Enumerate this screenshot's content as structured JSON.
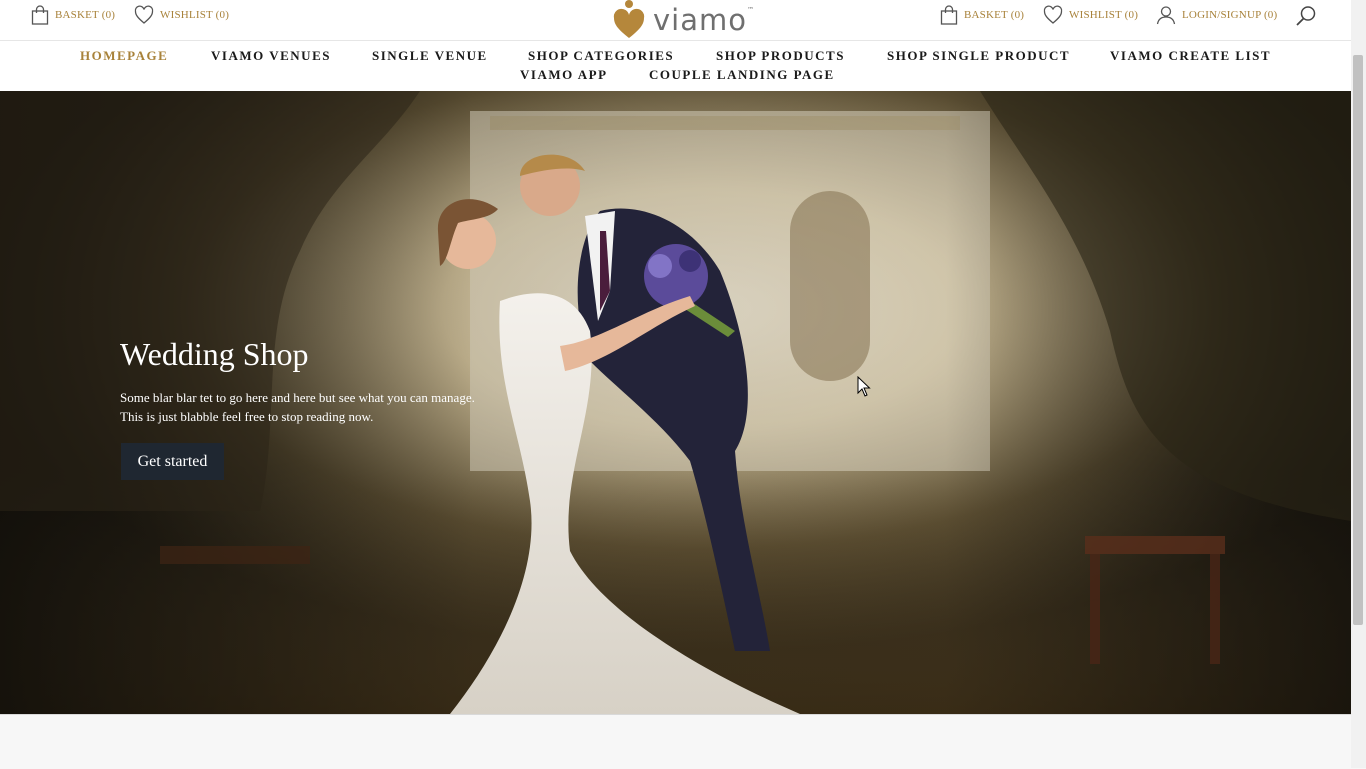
{
  "header": {
    "left_basket": {
      "label": "BASKET (0)",
      "icon": "shopping-bag-icon"
    },
    "left_wishlist": {
      "label": "WISHLIST (0)",
      "icon": "heart-icon"
    },
    "logo": {
      "text": "viamo",
      "tm": "™"
    },
    "right_basket": {
      "label": "BASKET (0)",
      "icon": "shopping-bag-icon"
    },
    "right_wishlist": {
      "label": "WISHLIST (0)",
      "icon": "heart-icon"
    },
    "login": {
      "label": "LOGIN/SIGNUP (0)",
      "icon": "user-icon"
    },
    "search_icon": "search-icon"
  },
  "nav": {
    "items": [
      {
        "label": "HOMEPAGE",
        "active": true
      },
      {
        "label": "VIAMO VENUES"
      },
      {
        "label": "SINGLE VENUE"
      },
      {
        "label": "SHOP CATEGORIES"
      },
      {
        "label": "SHOP PRODUCTS"
      },
      {
        "label": "SHOP SINGLE PRODUCT"
      },
      {
        "label": "VIAMO CREATE LIST"
      },
      {
        "label": "VIAMO APP"
      },
      {
        "label": "COUPLE LANDING PAGE"
      }
    ]
  },
  "hero": {
    "title": "Wedding Shop",
    "subtitle_line1": "Some blar blar tet to go here and here but see what you can manage.",
    "subtitle_line2": "This is just blabble feel free to stop reading now.",
    "button_label": "Get started"
  },
  "colors": {
    "accent": "#a8823a",
    "nav_text": "#1a1a1a",
    "button_bg": "#1f2731"
  }
}
